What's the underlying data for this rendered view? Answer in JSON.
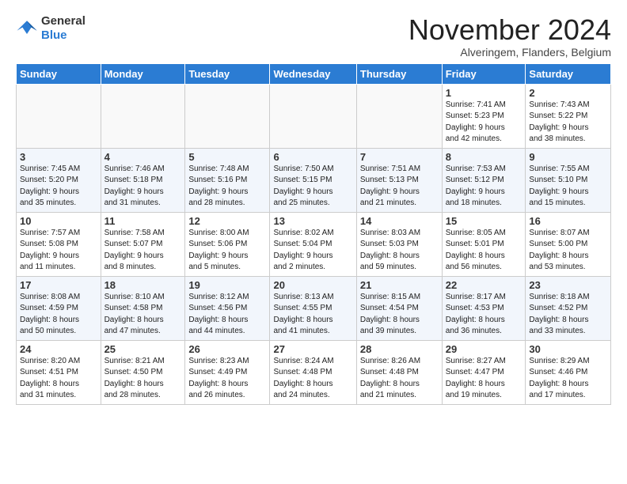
{
  "logo": {
    "general": "General",
    "blue": "Blue"
  },
  "title": "November 2024",
  "subtitle": "Alveringem, Flanders, Belgium",
  "days_of_week": [
    "Sunday",
    "Monday",
    "Tuesday",
    "Wednesday",
    "Thursday",
    "Friday",
    "Saturday"
  ],
  "weeks": [
    [
      {
        "day": "",
        "info": ""
      },
      {
        "day": "",
        "info": ""
      },
      {
        "day": "",
        "info": ""
      },
      {
        "day": "",
        "info": ""
      },
      {
        "day": "",
        "info": ""
      },
      {
        "day": "1",
        "info": "Sunrise: 7:41 AM\nSunset: 5:23 PM\nDaylight: 9 hours\nand 42 minutes."
      },
      {
        "day": "2",
        "info": "Sunrise: 7:43 AM\nSunset: 5:22 PM\nDaylight: 9 hours\nand 38 minutes."
      }
    ],
    [
      {
        "day": "3",
        "info": "Sunrise: 7:45 AM\nSunset: 5:20 PM\nDaylight: 9 hours\nand 35 minutes."
      },
      {
        "day": "4",
        "info": "Sunrise: 7:46 AM\nSunset: 5:18 PM\nDaylight: 9 hours\nand 31 minutes."
      },
      {
        "day": "5",
        "info": "Sunrise: 7:48 AM\nSunset: 5:16 PM\nDaylight: 9 hours\nand 28 minutes."
      },
      {
        "day": "6",
        "info": "Sunrise: 7:50 AM\nSunset: 5:15 PM\nDaylight: 9 hours\nand 25 minutes."
      },
      {
        "day": "7",
        "info": "Sunrise: 7:51 AM\nSunset: 5:13 PM\nDaylight: 9 hours\nand 21 minutes."
      },
      {
        "day": "8",
        "info": "Sunrise: 7:53 AM\nSunset: 5:12 PM\nDaylight: 9 hours\nand 18 minutes."
      },
      {
        "day": "9",
        "info": "Sunrise: 7:55 AM\nSunset: 5:10 PM\nDaylight: 9 hours\nand 15 minutes."
      }
    ],
    [
      {
        "day": "10",
        "info": "Sunrise: 7:57 AM\nSunset: 5:08 PM\nDaylight: 9 hours\nand 11 minutes."
      },
      {
        "day": "11",
        "info": "Sunrise: 7:58 AM\nSunset: 5:07 PM\nDaylight: 9 hours\nand 8 minutes."
      },
      {
        "day": "12",
        "info": "Sunrise: 8:00 AM\nSunset: 5:06 PM\nDaylight: 9 hours\nand 5 minutes."
      },
      {
        "day": "13",
        "info": "Sunrise: 8:02 AM\nSunset: 5:04 PM\nDaylight: 9 hours\nand 2 minutes."
      },
      {
        "day": "14",
        "info": "Sunrise: 8:03 AM\nSunset: 5:03 PM\nDaylight: 8 hours\nand 59 minutes."
      },
      {
        "day": "15",
        "info": "Sunrise: 8:05 AM\nSunset: 5:01 PM\nDaylight: 8 hours\nand 56 minutes."
      },
      {
        "day": "16",
        "info": "Sunrise: 8:07 AM\nSunset: 5:00 PM\nDaylight: 8 hours\nand 53 minutes."
      }
    ],
    [
      {
        "day": "17",
        "info": "Sunrise: 8:08 AM\nSunset: 4:59 PM\nDaylight: 8 hours\nand 50 minutes."
      },
      {
        "day": "18",
        "info": "Sunrise: 8:10 AM\nSunset: 4:58 PM\nDaylight: 8 hours\nand 47 minutes."
      },
      {
        "day": "19",
        "info": "Sunrise: 8:12 AM\nSunset: 4:56 PM\nDaylight: 8 hours\nand 44 minutes."
      },
      {
        "day": "20",
        "info": "Sunrise: 8:13 AM\nSunset: 4:55 PM\nDaylight: 8 hours\nand 41 minutes."
      },
      {
        "day": "21",
        "info": "Sunrise: 8:15 AM\nSunset: 4:54 PM\nDaylight: 8 hours\nand 39 minutes."
      },
      {
        "day": "22",
        "info": "Sunrise: 8:17 AM\nSunset: 4:53 PM\nDaylight: 8 hours\nand 36 minutes."
      },
      {
        "day": "23",
        "info": "Sunrise: 8:18 AM\nSunset: 4:52 PM\nDaylight: 8 hours\nand 33 minutes."
      }
    ],
    [
      {
        "day": "24",
        "info": "Sunrise: 8:20 AM\nSunset: 4:51 PM\nDaylight: 8 hours\nand 31 minutes."
      },
      {
        "day": "25",
        "info": "Sunrise: 8:21 AM\nSunset: 4:50 PM\nDaylight: 8 hours\nand 28 minutes."
      },
      {
        "day": "26",
        "info": "Sunrise: 8:23 AM\nSunset: 4:49 PM\nDaylight: 8 hours\nand 26 minutes."
      },
      {
        "day": "27",
        "info": "Sunrise: 8:24 AM\nSunset: 4:48 PM\nDaylight: 8 hours\nand 24 minutes."
      },
      {
        "day": "28",
        "info": "Sunrise: 8:26 AM\nSunset: 4:48 PM\nDaylight: 8 hours\nand 21 minutes."
      },
      {
        "day": "29",
        "info": "Sunrise: 8:27 AM\nSunset: 4:47 PM\nDaylight: 8 hours\nand 19 minutes."
      },
      {
        "day": "30",
        "info": "Sunrise: 8:29 AM\nSunset: 4:46 PM\nDaylight: 8 hours\nand 17 minutes."
      }
    ]
  ]
}
